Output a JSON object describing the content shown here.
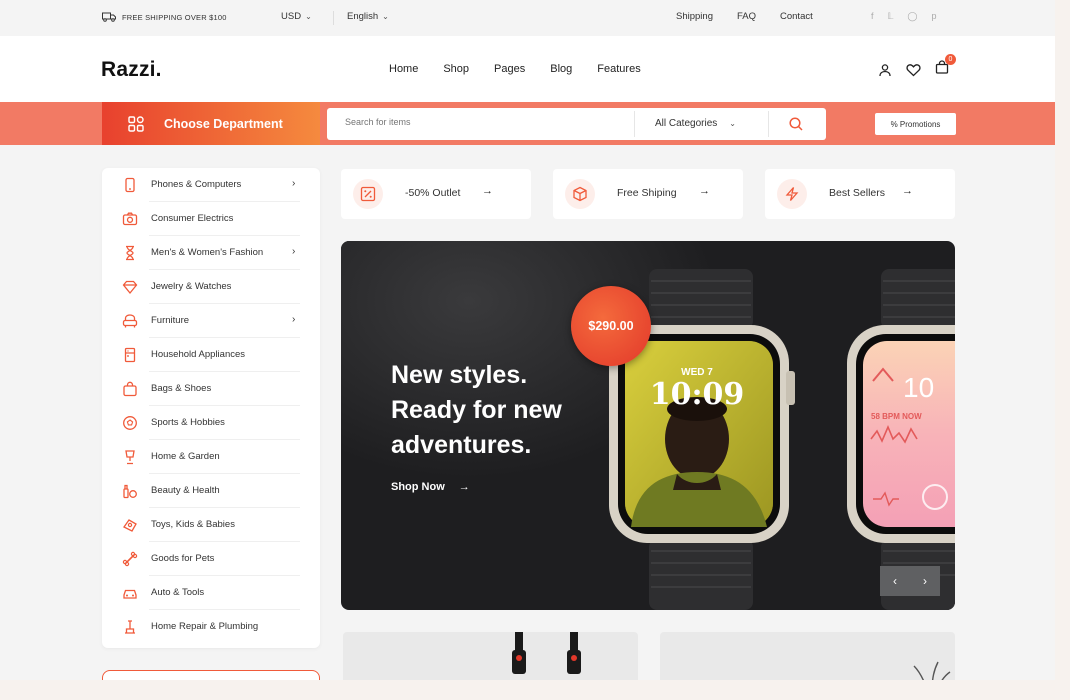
{
  "topbar": {
    "shipping_text": "FREE SHIPPING OVER $100",
    "currency": "USD",
    "language": "English",
    "links": [
      "Shipping",
      "FAQ",
      "Contact"
    ],
    "social_icons": [
      "facebook-icon",
      "twitter-icon",
      "instagram-icon",
      "pinterest-icon"
    ]
  },
  "header": {
    "logo": "Razzi.",
    "nav": [
      "Home",
      "Shop",
      "Pages",
      "Blog",
      "Features"
    ],
    "cart_count": "0"
  },
  "deptbar": {
    "department_label": "Choose Department",
    "search_placeholder": "Search for items",
    "category_select": "All Categories",
    "promo_label": "% Promotions"
  },
  "sidebar": {
    "categories": [
      {
        "label": "Phones & Computers",
        "has_submenu": true
      },
      {
        "label": "Consumer Electrics",
        "has_submenu": false
      },
      {
        "label": "Men's & Women's Fashion",
        "has_submenu": true
      },
      {
        "label": "Jewelry & Watches",
        "has_submenu": false
      },
      {
        "label": "Furniture",
        "has_submenu": true
      },
      {
        "label": "Household Appliances",
        "has_submenu": false
      },
      {
        "label": "Bags & Shoes",
        "has_submenu": false
      },
      {
        "label": "Sports & Hobbies",
        "has_submenu": false
      },
      {
        "label": "Home & Garden",
        "has_submenu": false
      },
      {
        "label": "Beauty & Health",
        "has_submenu": false
      },
      {
        "label": "Toys, Kids & Babies",
        "has_submenu": false
      },
      {
        "label": "Goods for Pets",
        "has_submenu": false
      },
      {
        "label": "Auto & Tools",
        "has_submenu": false
      },
      {
        "label": "Home Repair & Plumbing",
        "has_submenu": false
      }
    ]
  },
  "features": [
    {
      "label": "-50% Outlet",
      "icon": "percent-icon"
    },
    {
      "label": "Free Shiping",
      "icon": "box-icon"
    },
    {
      "label": "Best Sellers",
      "icon": "lightning-icon"
    }
  ],
  "hero": {
    "line1": "New styles.",
    "line2": "Ready for new",
    "line3": "adventures.",
    "cta": "Shop Now",
    "price": "$290.00",
    "watch1_date": "WED 7",
    "watch1_time": "10:09",
    "watch2_time": "10",
    "watch2_bpm": "58 BPM NOW"
  },
  "colors": {
    "accent": "#f05a3a",
    "deptbar_bg": "#f27a64",
    "hero_bg": "#1e1e20"
  }
}
